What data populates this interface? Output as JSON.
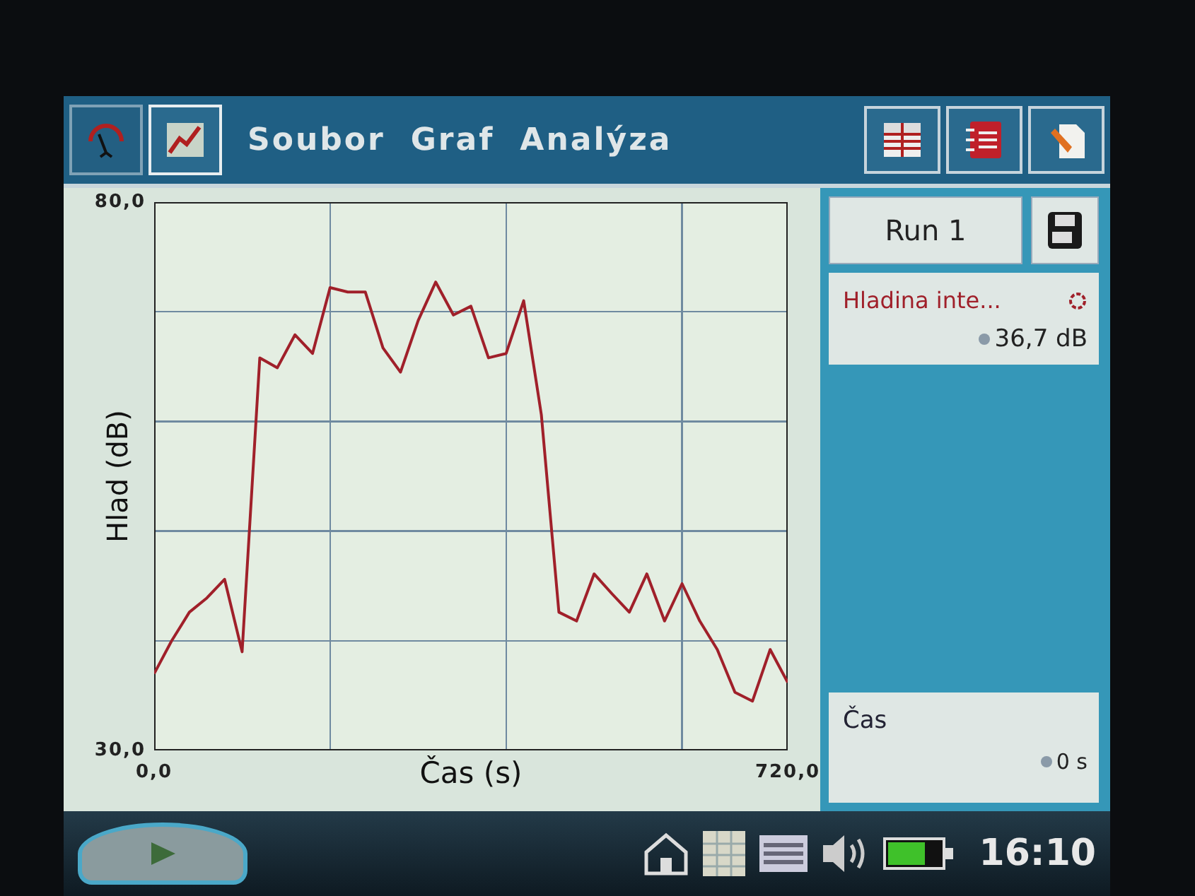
{
  "tabs": [
    {
      "kind": "meter",
      "selected": false
    },
    {
      "kind": "graph",
      "selected": true
    }
  ],
  "menu": [
    "Soubor",
    "Graf",
    "Analýza"
  ],
  "graph": {
    "chart_data": {
      "type": "line",
      "xlabel": "Čas (s)",
      "ylabel": "Hlad (dB)",
      "xlim": [
        0,
        720
      ],
      "ylim": [
        30,
        80
      ],
      "xticks": [
        {
          "value": 0,
          "label": "0,0"
        },
        {
          "value": 720,
          "label": "720,0"
        }
      ],
      "yticks": [
        {
          "value": 30,
          "label": "30,0"
        },
        {
          "value": 80,
          "label": "80,0"
        }
      ],
      "x": [
        0,
        20,
        40,
        60,
        80,
        100,
        120,
        140,
        160,
        180,
        200,
        220,
        240,
        260,
        280,
        300,
        320,
        340,
        360,
        380,
        400,
        420,
        440,
        460,
        480,
        500,
        520,
        540,
        560,
        580,
        600,
        620,
        640,
        660,
        680,
        700,
        720
      ],
      "series": [
        {
          "name": "Hladina inte...",
          "color": "#a0202a",
          "values": [
            37.0,
            40.0,
            42.6,
            43.9,
            45.6,
            39.0,
            65.8,
            64.9,
            67.9,
            66.2,
            72.2,
            71.8,
            71.8,
            66.7,
            64.5,
            69.2,
            72.7,
            69.7,
            70.5,
            65.8,
            66.2,
            71.0,
            60.6,
            42.6,
            41.8,
            46.1,
            44.3,
            42.6,
            46.1,
            41.8,
            45.2,
            41.8,
            39.2,
            35.3,
            34.5,
            39.2,
            36.2
          ]
        }
      ]
    }
  },
  "run": {
    "label": "Run 1"
  },
  "sensor": {
    "value": "36,7 dB"
  },
  "time_sensor": {
    "name": "Čas",
    "value": "0 s"
  },
  "clock": "16:10"
}
